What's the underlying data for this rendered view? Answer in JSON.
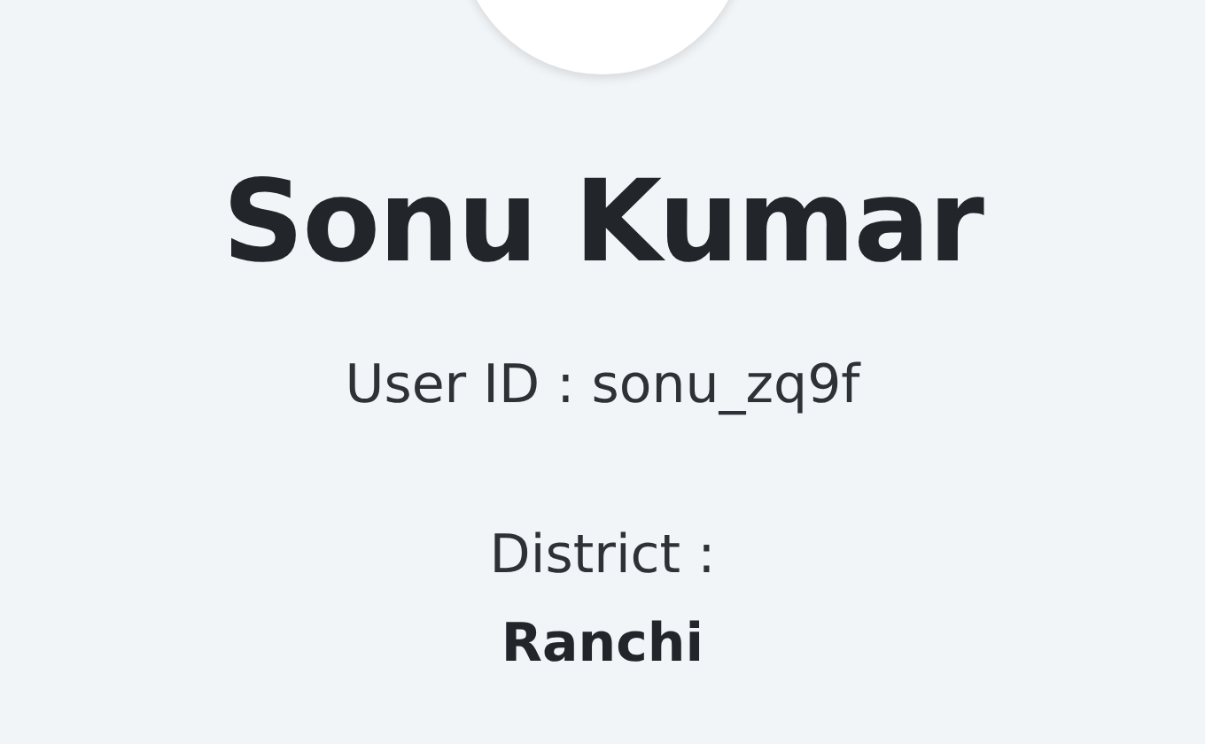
{
  "profile": {
    "name": "Sonu Kumar",
    "user_id": "User ID : sonu_zq9f",
    "district_label": "District :",
    "district": "Ranchi"
  }
}
